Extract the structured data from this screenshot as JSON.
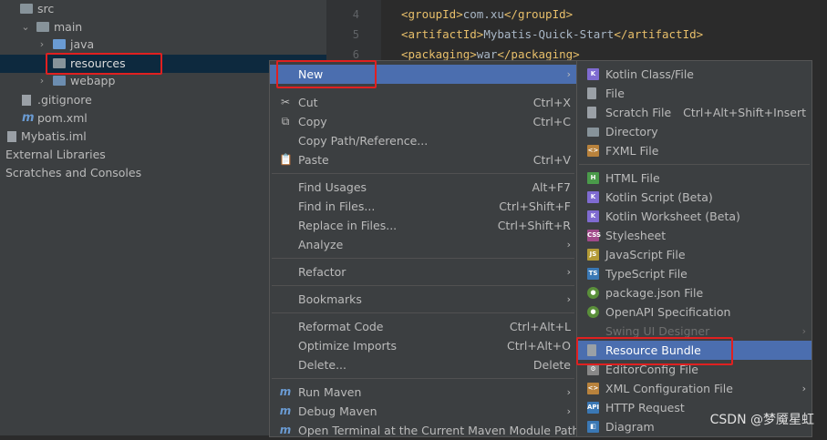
{
  "tree": {
    "src": "src",
    "main": "main",
    "java": "java",
    "resources": "resources",
    "webapp": "webapp",
    "gitignore": ".gitignore",
    "pom": "pom.xml",
    "iml": "Mybatis.iml",
    "external": "External Libraries",
    "scratches": "Scratches and Consoles"
  },
  "editor": {
    "line_numbers": [
      "4",
      "5",
      "6"
    ],
    "lines": [
      {
        "open": "<groupId>",
        "text": "com.xu",
        "close": "</groupId>"
      },
      {
        "open": "<artifactId>",
        "text": "Mybatis-Quick-Start",
        "close": "</artifactId>"
      },
      {
        "open": "<packaging>",
        "text": "war",
        "close": "</packaging>"
      }
    ]
  },
  "menu": {
    "new": "New",
    "cut": "Cut",
    "cut_sc": "Ctrl+X",
    "copy": "Copy",
    "copy_sc": "Ctrl+C",
    "copy_path": "Copy Path/Reference...",
    "paste": "Paste",
    "paste_sc": "Ctrl+V",
    "find_usages": "Find Usages",
    "find_usages_sc": "Alt+F7",
    "find_in_files": "Find in Files...",
    "find_in_files_sc": "Ctrl+Shift+F",
    "replace_in_files": "Replace in Files...",
    "replace_in_files_sc": "Ctrl+Shift+R",
    "analyze": "Analyze",
    "refactor": "Refactor",
    "bookmarks": "Bookmarks",
    "reformat": "Reformat Code",
    "reformat_sc": "Ctrl+Alt+L",
    "optimize": "Optimize Imports",
    "optimize_sc": "Ctrl+Alt+O",
    "delete": "Delete...",
    "delete_sc": "Delete",
    "run_maven": "Run Maven",
    "debug_maven": "Debug Maven",
    "open_terminal": "Open Terminal at the Current Maven Module Path"
  },
  "submenu": {
    "kotlin_class": "Kotlin Class/File",
    "file": "File",
    "scratch": "Scratch File",
    "scratch_sc": "Ctrl+Alt+Shift+Insert",
    "directory": "Directory",
    "fxml": "FXML File",
    "html": "HTML File",
    "kotlin_script": "Kotlin Script (Beta)",
    "kotlin_worksheet": "Kotlin Worksheet (Beta)",
    "stylesheet": "Stylesheet",
    "javascript": "JavaScript File",
    "typescript": "TypeScript File",
    "package_json": "package.json File",
    "openapi": "OpenAPI Specification",
    "swing": "Swing UI Designer",
    "resource_bundle": "Resource Bundle",
    "editorconfig": "EditorConfig File",
    "xml_config": "XML Configuration File",
    "http_request": "HTTP Request",
    "diagram": "Diagram"
  },
  "watermark": "CSDN @梦魇星虹",
  "colors": {
    "highlight": "#4b6eaf",
    "annotation": "#e02020"
  }
}
